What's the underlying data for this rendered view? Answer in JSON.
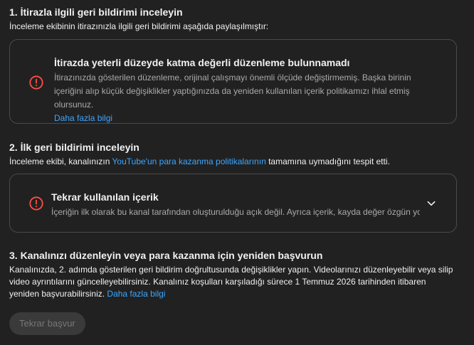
{
  "section1": {
    "title": "1. İtirazla ilgili geri bildirimi inceleyin",
    "subtitle": "İnceleme ekibinin itirazınızla ilgili geri bildirimi aşağıda paylaşılmıştır:",
    "card": {
      "title": "İtirazda yeterli düzeyde katma değerli düzenleme bulunnamadı",
      "body": "İtirazınızda gösterilen düzenleme, orijinal çalışmayı önemli ölçüde değiştirmemiş. Başka birinin içeriğini alıp küçük değişiklikler yaptığınızda da yeniden kullanılan içerik politikamızı ihlal etmiş olursunuz.",
      "link": "Daha fazla bilgi"
    }
  },
  "section2": {
    "title": "2. İlk geri bildirimi inceleyin",
    "text_before": "İnceleme ekibi, kanalınızın ",
    "link": "YouTube'un para kazanma politikalarının",
    "text_after": " tamamına uymadığını tespit etti.",
    "card": {
      "title": "Tekrar kullanılan içerik",
      "body": "İçeriğin ilk olarak bu kanal tarafından oluşturulduğu açık değil. Ayrıca içerik, kayda değer özgün yorum"
    }
  },
  "section3": {
    "title": "3. Kanalınızı düzenleyin veya para kazanma için yeniden başvurun",
    "text": "Kanalınızda, 2. adımda gösterilen geri bildirim doğrultusunda değişiklikler yapın. Videolarınızı düzenleyebilir veya silip video ayrıntılarını güncelleyebilirsiniz. Kanalınız koşulları karşıladığı sürece 1 Temmuz 2026 tarihinden itibaren yeniden başvurabilirsiniz. ",
    "link": "Daha fazla bilgi",
    "button": "Tekrar başvur"
  },
  "colors": {
    "background": "#212121",
    "alert": "#ff4e45",
    "link": "#3ea6ff",
    "border": "#4a4a4a"
  },
  "icons": {
    "alert": "alert-circle-icon",
    "expand": "chevron-down-icon"
  }
}
